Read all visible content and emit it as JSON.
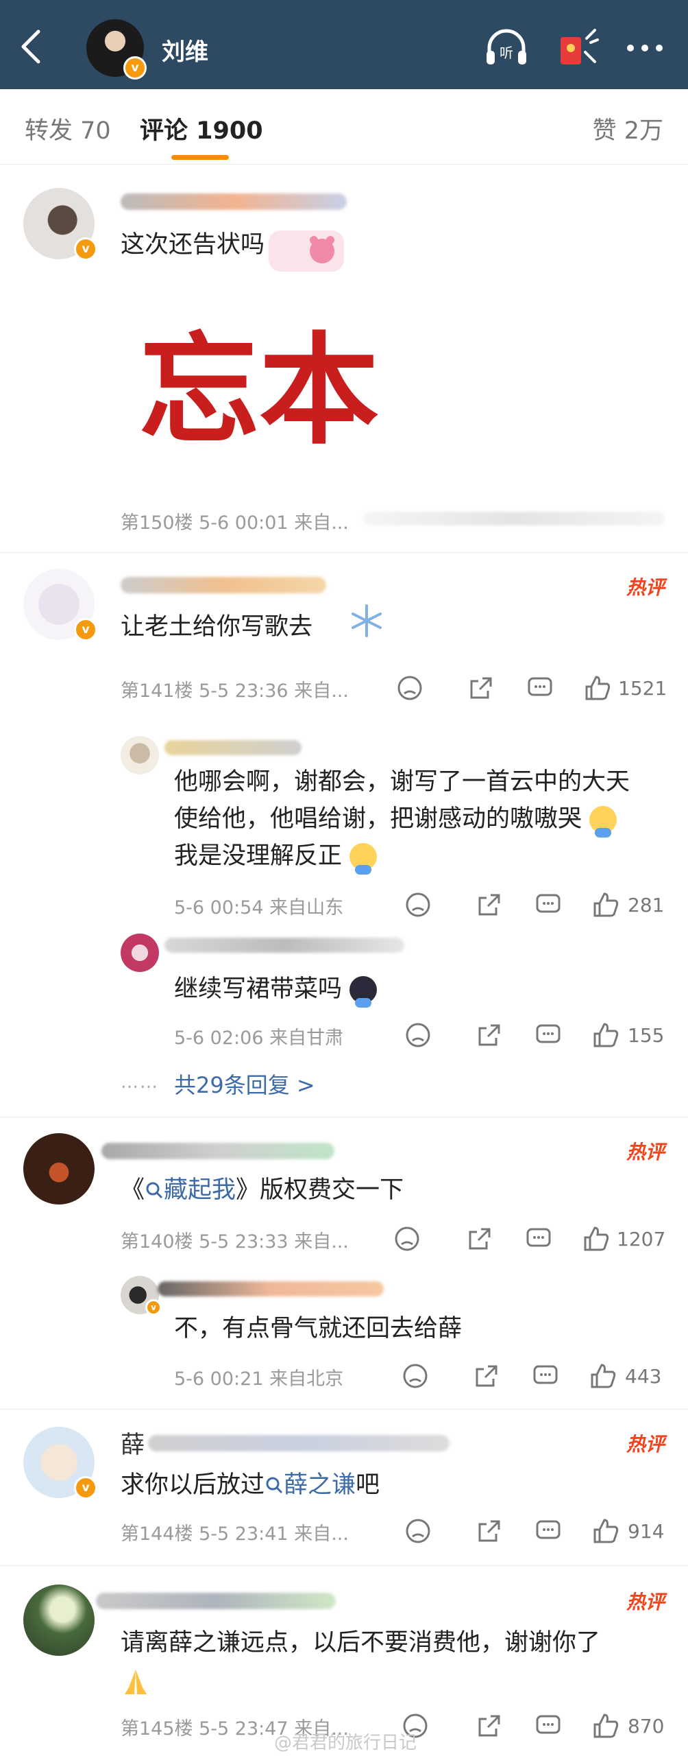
{
  "header": {
    "title": "刘维"
  },
  "tabs": [
    {
      "label": "转发 70"
    },
    {
      "label": "评论 1900"
    },
    {
      "label": "赞 2万"
    }
  ],
  "comments": [
    {
      "text": "这次还告状吗",
      "image_text": "忘本",
      "meta": "第150楼 5-6 00:01 来自..."
    },
    {
      "hot": "热评",
      "text": "让老土给你写歌去",
      "meta": "第141楼 5-5 23:36 来自...",
      "likes": "1521",
      "replies": [
        {
          "lines": [
            "他哪会啊，谢都会，谢写了一首云中的大天",
            "使给他，他唱给谢，把谢感动的嗷嗷哭",
            "我是没理解反正"
          ],
          "meta": "5-6 00:54 来自山东",
          "likes": "281"
        },
        {
          "lines": [
            "继续写裙带菜吗"
          ],
          "meta": "5-6 02:06 来自甘肃",
          "likes": "155"
        }
      ],
      "more_replies": "共29条回复 >"
    },
    {
      "hot": "热评",
      "text_before": "《",
      "link": "藏起我",
      "text_after": "》版权费交一下",
      "meta": "第140楼 5-5 23:33 来自...",
      "likes": "1207",
      "replies": [
        {
          "lines": [
            "不，有点骨气就还回去给薛"
          ],
          "meta": "5-6 00:21 来自北京",
          "likes": "443"
        }
      ]
    },
    {
      "hot": "热评",
      "name_visible": "薛",
      "text_before": "求你以后放过",
      "link": "薛之谦",
      "text_after": "吧",
      "meta": "第144楼 5-5 23:41 来自...",
      "likes": "914"
    },
    {
      "hot": "热评",
      "text": "请离薛之谦远点，以后不要消费他，谢谢你了",
      "meta": "第145楼 5-5 23:47 来自...",
      "likes": "870"
    }
  ],
  "watermark": "@君君的旅行日记",
  "colors": {
    "header_bg": "#2e4a63",
    "accent": "#ff8a00",
    "hot": "#f0441e",
    "link": "#3d6aa8"
  }
}
